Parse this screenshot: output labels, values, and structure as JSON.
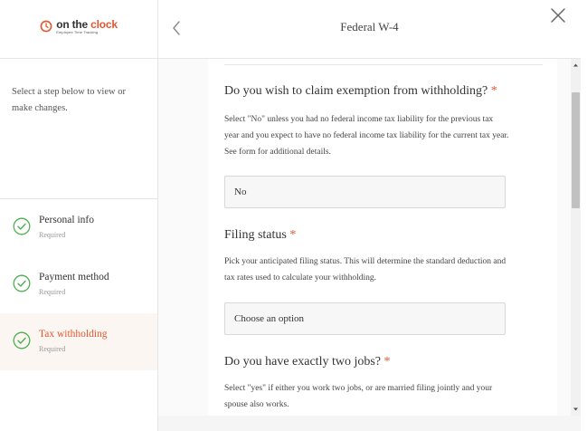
{
  "brand": {
    "name_part1": "on the ",
    "name_part2": "clock",
    "tagline": "Employee Time Tracking",
    "accent_color": "#e4572e"
  },
  "sidebar": {
    "hint": "Select a step below to view or make changes.",
    "steps": [
      {
        "label": "Personal info",
        "sub": "Required",
        "icon": "check-circle-icon",
        "active": false
      },
      {
        "label": "Payment method",
        "sub": "Required",
        "icon": "check-circle-icon",
        "active": false
      },
      {
        "label": "Tax withholding",
        "sub": "Required",
        "icon": "check-circle-icon",
        "active": true
      }
    ]
  },
  "header": {
    "title": "Federal W-4",
    "back_icon": "chevron-left-icon",
    "close_icon": "close-icon"
  },
  "form": {
    "required_marker": "*",
    "questions": [
      {
        "title": "Do you wish to claim exemption from withholding?",
        "description": "Select \"No\" unless you had no federal income tax liability for the previous tax year and you expect to have no federal income tax liability for the current tax year. See form for additional details.",
        "value": "No"
      },
      {
        "title": "Filing status",
        "description": "Pick your anticipated filing status. This will determine the standard deduction and tax rates used to calculate your withholding.",
        "value": "Choose an option"
      },
      {
        "title": "Do you have exactly two jobs?",
        "description": "Select \"yes\" if either you work two jobs, or are married filing jointly and your spouse also works."
      }
    ]
  },
  "colors": {
    "check_green": "#4caf50",
    "active_bg": "#fbf6f2"
  }
}
